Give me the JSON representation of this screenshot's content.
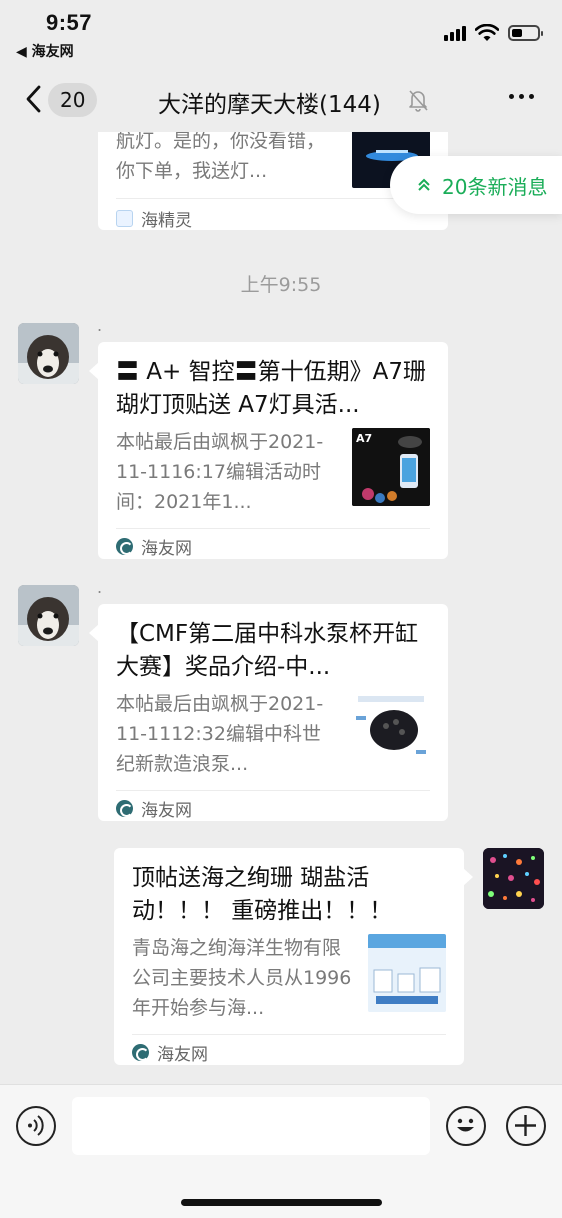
{
  "status_bar": {
    "time": "9:57",
    "back_app": "◀ 海友网",
    "battery_percent": 40
  },
  "nav": {
    "unread_count": "20",
    "title": "大洋的摩天大楼(144)"
  },
  "new_messages": {
    "label": "20条新消息"
  },
  "messages": {
    "partial_card": {
      "desc": "航灯。是的，你没看错，你下单，我送灯...",
      "source": "海精灵"
    },
    "timestamp": "上午9:55",
    "card1": {
      "sender": ".",
      "title": "〓 A+ 智控〓第十伍期》A7珊 瑚灯顶贴送 A7灯具活...",
      "desc": "本帖最后由飒枫于2021-11-1116:17编辑活动时间：2021年1...",
      "thumb_label": "A7",
      "source": "海友网"
    },
    "card2": {
      "sender": ".",
      "title": "【CMF第二届中科水泵杯开缸大赛】奖品介绍-中...",
      "desc": "本帖最后由飒枫于2021-11-1112:32编辑中科世纪新款造浪泵...",
      "source": "海友网"
    },
    "card3": {
      "title": "顶帖送海之绚珊 瑚盐活动！！！ 重磅推出！！！",
      "desc": "青岛海之绚海洋生物有限公司主要技术人员从1996年开始参与海...",
      "source": "海友网"
    }
  },
  "input": {
    "value": ""
  }
}
